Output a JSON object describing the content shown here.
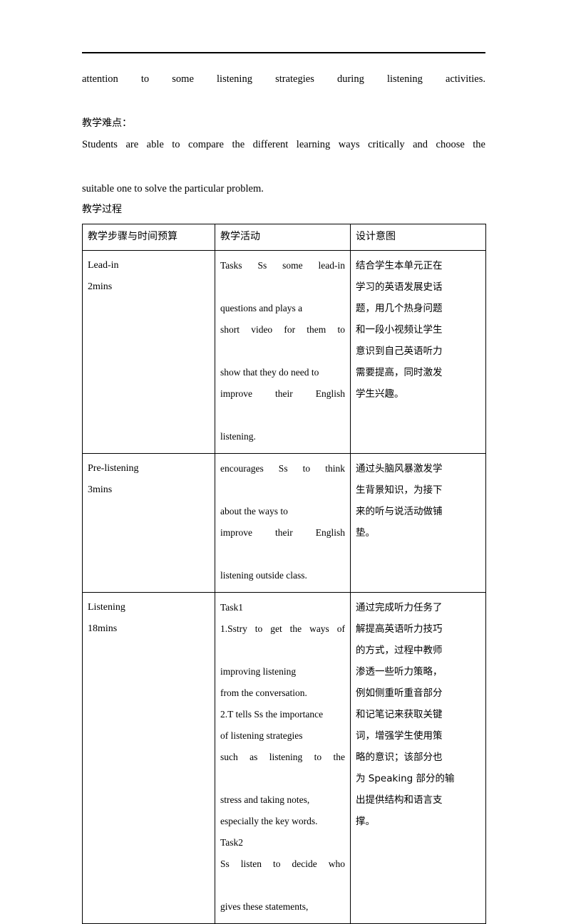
{
  "document": {
    "top_paragraphs": [
      {
        "id": "p1",
        "lang": "en",
        "text": "attention to some listening strategies during listening activities."
      },
      {
        "id": "p2",
        "lang": "cn",
        "text": "教学难点："
      },
      {
        "id": "p3",
        "lang": "en",
        "text": "Students are able to compare the different learning ways critically and choose the"
      },
      {
        "id": "p4",
        "lang": "en",
        "text": "suitable one to solve the particular problem."
      },
      {
        "id": "p5",
        "lang": "cn",
        "text": "教学过程"
      }
    ]
  },
  "table": {
    "headers": [
      "教学步骤与时间预算",
      "教学活动",
      "设计意图"
    ],
    "rows": [
      {
        "step": {
          "name": "Lead-in",
          "time": "2mins"
        },
        "activity_lines": [
          "Tasks Ss some lead-in",
          "questions and plays a",
          "short video for them to",
          "show that they do need to",
          "improve their English",
          "listening."
        ],
        "intent_lines": [
          "结合学生本单元正在",
          "学习的英语发展史话",
          "题，用几个热身问题",
          "和一段小视频让学生",
          "意识到自己英语听力",
          "需要提高，同时激发",
          "学生兴趣。"
        ]
      },
      {
        "step": {
          "name": "Pre-listening",
          "time": "3mins"
        },
        "activity_lines": [
          "encourages Ss to think",
          "about the ways to",
          "improve their English",
          "listening outside class."
        ],
        "intent_lines": [
          "通过头脑风暴激发学",
          "生背景知识，为接下",
          "来的听与说活动做铺",
          "垫。"
        ]
      },
      {
        "step": {
          "name": "Listening",
          "time": "18mins"
        },
        "activity_lines": [
          "Task1",
          "1.Sstry to get the ways of",
          "improving listening",
          "from the conversation.",
          "2.T tells Ss the importance",
          "of listening strategies",
          "such as listening to the",
          "stress and taking notes,",
          "especially the key words.",
          "Task2",
          "Ss listen to decide who",
          "gives these statements,"
        ],
        "intent_lines": [
          "通过完成听力任务了",
          "解提高英语听力技巧",
          "的方式，过程中教师",
          "渗透一些听力策略，",
          "例如侧重听重音部分",
          "和记笔记来获取关键",
          "词，增强学生使用策",
          "略的意识；该部分也",
          "为 Speaking 部分的输",
          "出提供结构和语言支",
          "撑。"
        ]
      }
    ]
  },
  "style": {
    "text_color": "#000000",
    "border_color": "#000000",
    "page_background": "#ffffff"
  }
}
